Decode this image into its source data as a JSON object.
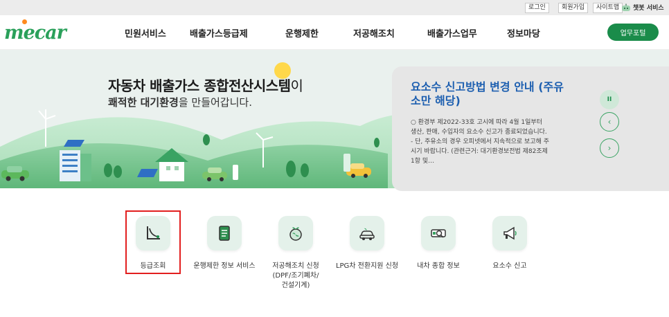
{
  "topbar": {
    "login": "로그인",
    "signup": "회원가입",
    "sitemap": "사이트맵",
    "chatbot": "챗봇 서비스"
  },
  "header": {
    "logo": "mecar",
    "nav": [
      "민원서비스",
      "배출가스등급제",
      "운행제한",
      "저공해조치",
      "배출가스업무",
      "정보마당"
    ],
    "portal_button": "업무포털"
  },
  "hero": {
    "title_bold": "자동차 배출가스 종합전산시스템",
    "title_suffix": "이",
    "sub_bold": "쾌적한 대기환경",
    "sub_rest": "을 만들어갑니다."
  },
  "notice": {
    "title": "요소수 신고방법 변경 안내 (주유소만 해당)",
    "body": "○ 환경부 제2022-33호 고시에 따라 4월 1일부터 생산, 판매, 수입자의 요소수 신고가 종료되었습니다. - 단, 주유소의 경우 오피넷에서 지속적으로 보고해 주시기 바랍니다. (관련근거: 대기환경보전법 제82조제1항 및…",
    "pause_label": "II",
    "prev_label": "‹",
    "next_label": "›"
  },
  "quick_menu": [
    {
      "label": "등급조회",
      "icon": "grade-chart-icon"
    },
    {
      "label": "운행제한 정보 서비스",
      "icon": "document-icon"
    },
    {
      "label": "저공해조치 신청\n(DPF/조기폐차/\n건설기계)",
      "icon": "globe-leaf-icon"
    },
    {
      "label": "LPG차 전환지원 신청",
      "icon": "eco-car-icon"
    },
    {
      "label": "내차 종합 정보",
      "icon": "car-search-icon"
    },
    {
      "label": "요소수 신고",
      "icon": "megaphone-icon"
    }
  ],
  "colors": {
    "brand_green": "#1a8c4a",
    "notice_blue": "#1d5fb0",
    "highlight_red": "#e21e1e"
  }
}
